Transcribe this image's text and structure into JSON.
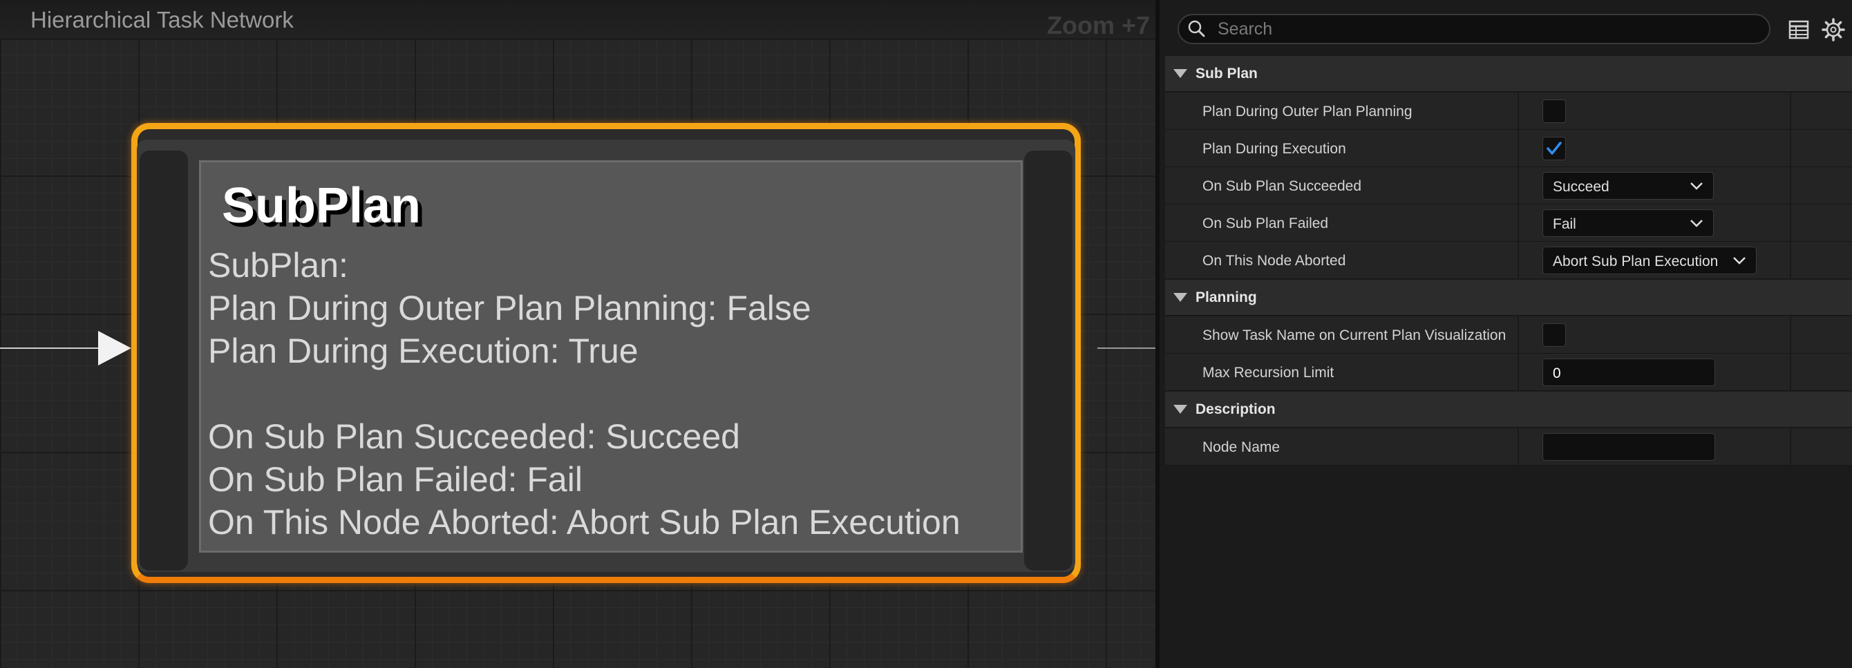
{
  "graph": {
    "title": "Hierarchical Task Network",
    "zoom": "Zoom +7",
    "node": {
      "title": "SubPlan",
      "lines": [
        "SubPlan:",
        "Plan During Outer Plan Planning: False",
        "Plan During Execution: True",
        "On Sub Plan Succeeded: Succeed",
        "On Sub Plan Failed: Fail",
        "On This Node Aborted: Abort Sub Plan Execution"
      ]
    }
  },
  "details": {
    "search": {
      "placeholder": "Search"
    },
    "icons": {
      "table": "table-view-icon",
      "settings": "gear-icon"
    },
    "categories": [
      {
        "label": "Sub Plan",
        "properties": [
          {
            "label": "Plan During Outer Plan Planning",
            "type": "checkbox",
            "checked": false
          },
          {
            "label": "Plan During Execution",
            "type": "checkbox",
            "checked": true
          },
          {
            "label": "On Sub Plan Succeeded",
            "type": "combo",
            "value": "Succeed"
          },
          {
            "label": "On Sub Plan Failed",
            "type": "combo",
            "value": "Fail"
          },
          {
            "label": "On This Node Aborted",
            "type": "combo",
            "value": "Abort Sub Plan Execution"
          }
        ]
      },
      {
        "label": "Planning",
        "properties": [
          {
            "label": "Show Task Name on Current Plan Visualization",
            "type": "checkbox",
            "checked": false
          },
          {
            "label": "Max Recursion Limit",
            "type": "number",
            "value": "0"
          }
        ]
      },
      {
        "label": "Description",
        "properties": [
          {
            "label": "Node Name",
            "type": "text",
            "value": ""
          }
        ]
      }
    ],
    "colors": {
      "accent_orange": "#f4a516",
      "check_blue": "#2f8ff0"
    }
  }
}
